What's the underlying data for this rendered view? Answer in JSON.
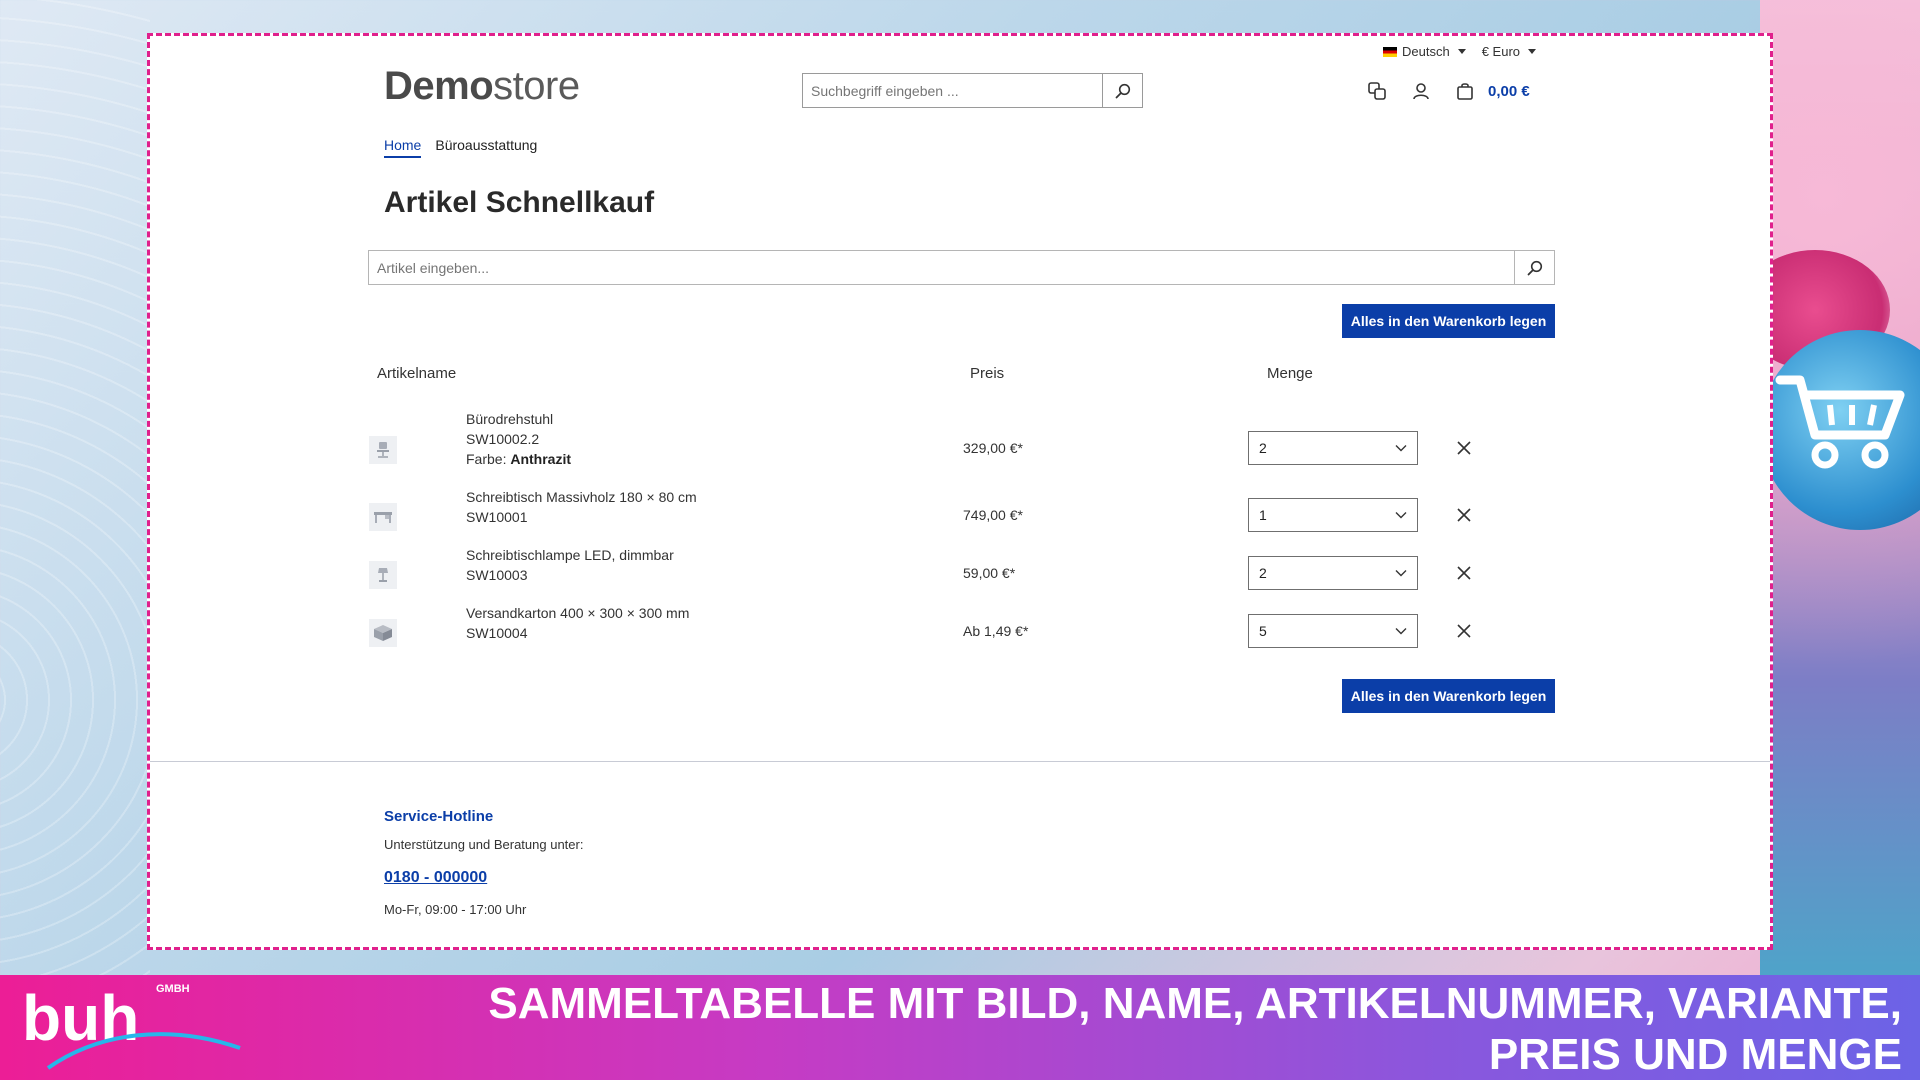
{
  "header": {
    "language": "Deutsch",
    "currency": "€ Euro",
    "logo_bold": "Demo",
    "logo_light": "store",
    "search_placeholder": "Suchbegriff eingeben ...",
    "cart_total": "0,00 €"
  },
  "breadcrumb": [
    {
      "label": "Home",
      "active": true
    },
    {
      "label": "Büroausstattung",
      "active": false
    }
  ],
  "page": {
    "title": "Artikel Schnellkauf",
    "search_placeholder": "Artikel eingeben...",
    "add_all_label": "Alles in den Warenkorb legen"
  },
  "table": {
    "columns": {
      "name": "Artikelname",
      "price": "Preis",
      "quantity": "Menge"
    },
    "rows": [
      {
        "name": "Bürodrehstuhl",
        "sku": "SW10002.2",
        "variant_label": "Farbe:",
        "variant_value": "Anthrazit",
        "price": "329,00 €*",
        "quantity": "2",
        "image_icon": "chair-icon"
      },
      {
        "name": "Schreibtisch Massivholz 180 × 80 cm",
        "sku": "SW10001",
        "price": "749,00 €*",
        "quantity": "1",
        "image_icon": "desk-icon"
      },
      {
        "name": "Schreibtischlampe LED, dimmbar",
        "sku": "SW10003",
        "price": "59,00 €*",
        "quantity": "2",
        "image_icon": "lamp-icon"
      },
      {
        "name": "Versandkarton 400 × 300 × 300 mm",
        "sku": "SW10004",
        "price": "Ab 1,49 €*",
        "quantity": "5",
        "image_icon": "box-icon"
      }
    ]
  },
  "footer": {
    "title": "Service-Hotline",
    "text": "Unterstützung und Beratung unter:",
    "phone": "0180 - 000000",
    "hours": "Mo-Fr, 09:00 - 17:00 Uhr"
  },
  "banner": {
    "logo_text": "buh",
    "logo_sub": "GMBH",
    "line1": "SAMMELTABELLE MIT BILD, NAME, ARTIKELNUMMER, VARIANTE,",
    "line2": "PREIS UND MENGE"
  },
  "colors": {
    "accent": "#0b3ea8",
    "frame_border": "#e0208c",
    "banner_start": "#ec1e96",
    "banner_end": "#6c63e6"
  }
}
